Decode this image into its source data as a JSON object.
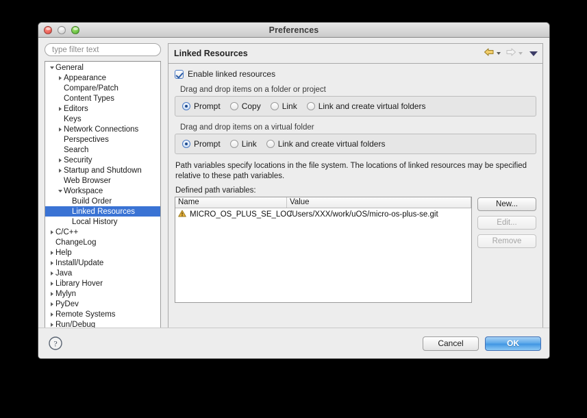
{
  "window": {
    "title": "Preferences",
    "controls": {
      "close": "close-button",
      "minimize": "minimize-button",
      "zoom": "zoom-button"
    }
  },
  "sidebar": {
    "filter_placeholder": "type filter text",
    "items": [
      {
        "label": "General",
        "indent": 0,
        "twisty": "open",
        "selected": false
      },
      {
        "label": "Appearance",
        "indent": 1,
        "twisty": "closed",
        "selected": false
      },
      {
        "label": "Compare/Patch",
        "indent": 1,
        "twisty": "none",
        "selected": false
      },
      {
        "label": "Content Types",
        "indent": 1,
        "twisty": "none",
        "selected": false
      },
      {
        "label": "Editors",
        "indent": 1,
        "twisty": "closed",
        "selected": false
      },
      {
        "label": "Keys",
        "indent": 1,
        "twisty": "none",
        "selected": false
      },
      {
        "label": "Network Connections",
        "indent": 1,
        "twisty": "closed",
        "selected": false
      },
      {
        "label": "Perspectives",
        "indent": 1,
        "twisty": "none",
        "selected": false
      },
      {
        "label": "Search",
        "indent": 1,
        "twisty": "none",
        "selected": false
      },
      {
        "label": "Security",
        "indent": 1,
        "twisty": "closed",
        "selected": false
      },
      {
        "label": "Startup and Shutdown",
        "indent": 1,
        "twisty": "closed",
        "selected": false
      },
      {
        "label": "Web Browser",
        "indent": 1,
        "twisty": "none",
        "selected": false
      },
      {
        "label": "Workspace",
        "indent": 1,
        "twisty": "open",
        "selected": false
      },
      {
        "label": "Build Order",
        "indent": 2,
        "twisty": "none",
        "selected": false
      },
      {
        "label": "Linked Resources",
        "indent": 2,
        "twisty": "none",
        "selected": true
      },
      {
        "label": "Local History",
        "indent": 2,
        "twisty": "none",
        "selected": false
      },
      {
        "label": "C/C++",
        "indent": 0,
        "twisty": "closed",
        "selected": false
      },
      {
        "label": "ChangeLog",
        "indent": 0,
        "twisty": "none",
        "selected": false
      },
      {
        "label": "Help",
        "indent": 0,
        "twisty": "closed",
        "selected": false
      },
      {
        "label": "Install/Update",
        "indent": 0,
        "twisty": "closed",
        "selected": false
      },
      {
        "label": "Java",
        "indent": 0,
        "twisty": "closed",
        "selected": false
      },
      {
        "label": "Library Hover",
        "indent": 0,
        "twisty": "closed",
        "selected": false
      },
      {
        "label": "Mylyn",
        "indent": 0,
        "twisty": "closed",
        "selected": false
      },
      {
        "label": "PyDev",
        "indent": 0,
        "twisty": "closed",
        "selected": false
      },
      {
        "label": "Remote Systems",
        "indent": 0,
        "twisty": "closed",
        "selected": false
      },
      {
        "label": "Run/Debug",
        "indent": 0,
        "twisty": "closed",
        "selected": false
      }
    ]
  },
  "page": {
    "title": "Linked Resources",
    "enable_checkbox": {
      "label": "Enable linked resources",
      "checked": true
    },
    "group_folder": {
      "label": "Drag and drop items on a folder or project",
      "options": [
        {
          "label": "Prompt",
          "selected": true
        },
        {
          "label": "Copy",
          "selected": false
        },
        {
          "label": "Link",
          "selected": false
        },
        {
          "label": "Link and create virtual folders",
          "selected": false
        }
      ]
    },
    "group_virtual": {
      "label": "Drag and drop items on a virtual folder",
      "options": [
        {
          "label": "Prompt",
          "selected": true
        },
        {
          "label": "Link",
          "selected": false
        },
        {
          "label": "Link and create virtual folders",
          "selected": false
        }
      ]
    },
    "description": "Path variables specify locations in the file system. The locations of linked resources may be specified relative to these path variables.",
    "defined_label": "Defined path variables:",
    "table": {
      "columns": [
        "Name",
        "Value"
      ],
      "rows": [
        {
          "name": "MICRO_OS_PLUS_SE_LOC",
          "value": "/Users/XXX/work/uOS/micro-os-plus-se.git",
          "status": "warning"
        }
      ]
    },
    "side_buttons": [
      {
        "label": "New...",
        "enabled": true
      },
      {
        "label": "Edit...",
        "enabled": false
      },
      {
        "label": "Remove",
        "enabled": false
      }
    ]
  },
  "footer": {
    "help": "help-button",
    "cancel": "Cancel",
    "ok": "OK"
  },
  "colors": {
    "selection": "#3a73d4",
    "warning": "#e8b33c",
    "primary_button": "#3f95e3"
  }
}
